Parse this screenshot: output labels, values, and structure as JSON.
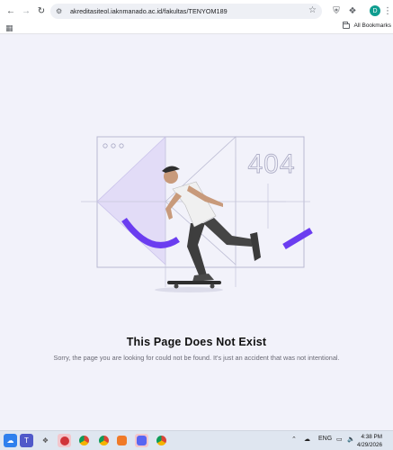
{
  "browser": {
    "url": "akreditasiteol.iaknmanado.ac.id/fakultas/TENYOM189",
    "all_bookmarks_label": "All Bookmarks",
    "profile_initial": "D"
  },
  "page": {
    "illustration_code": "404",
    "title": "This Page Does Not Exist",
    "description": "Sorry, the page you are looking for could not be found. It's just an accident that was not intentional.",
    "accent_color": "#6b3df0",
    "light_accent_color": "#e2dcf7"
  },
  "taskbar": {
    "language": "ENG",
    "time": "4:38 PM",
    "date": "4/29/2026"
  }
}
